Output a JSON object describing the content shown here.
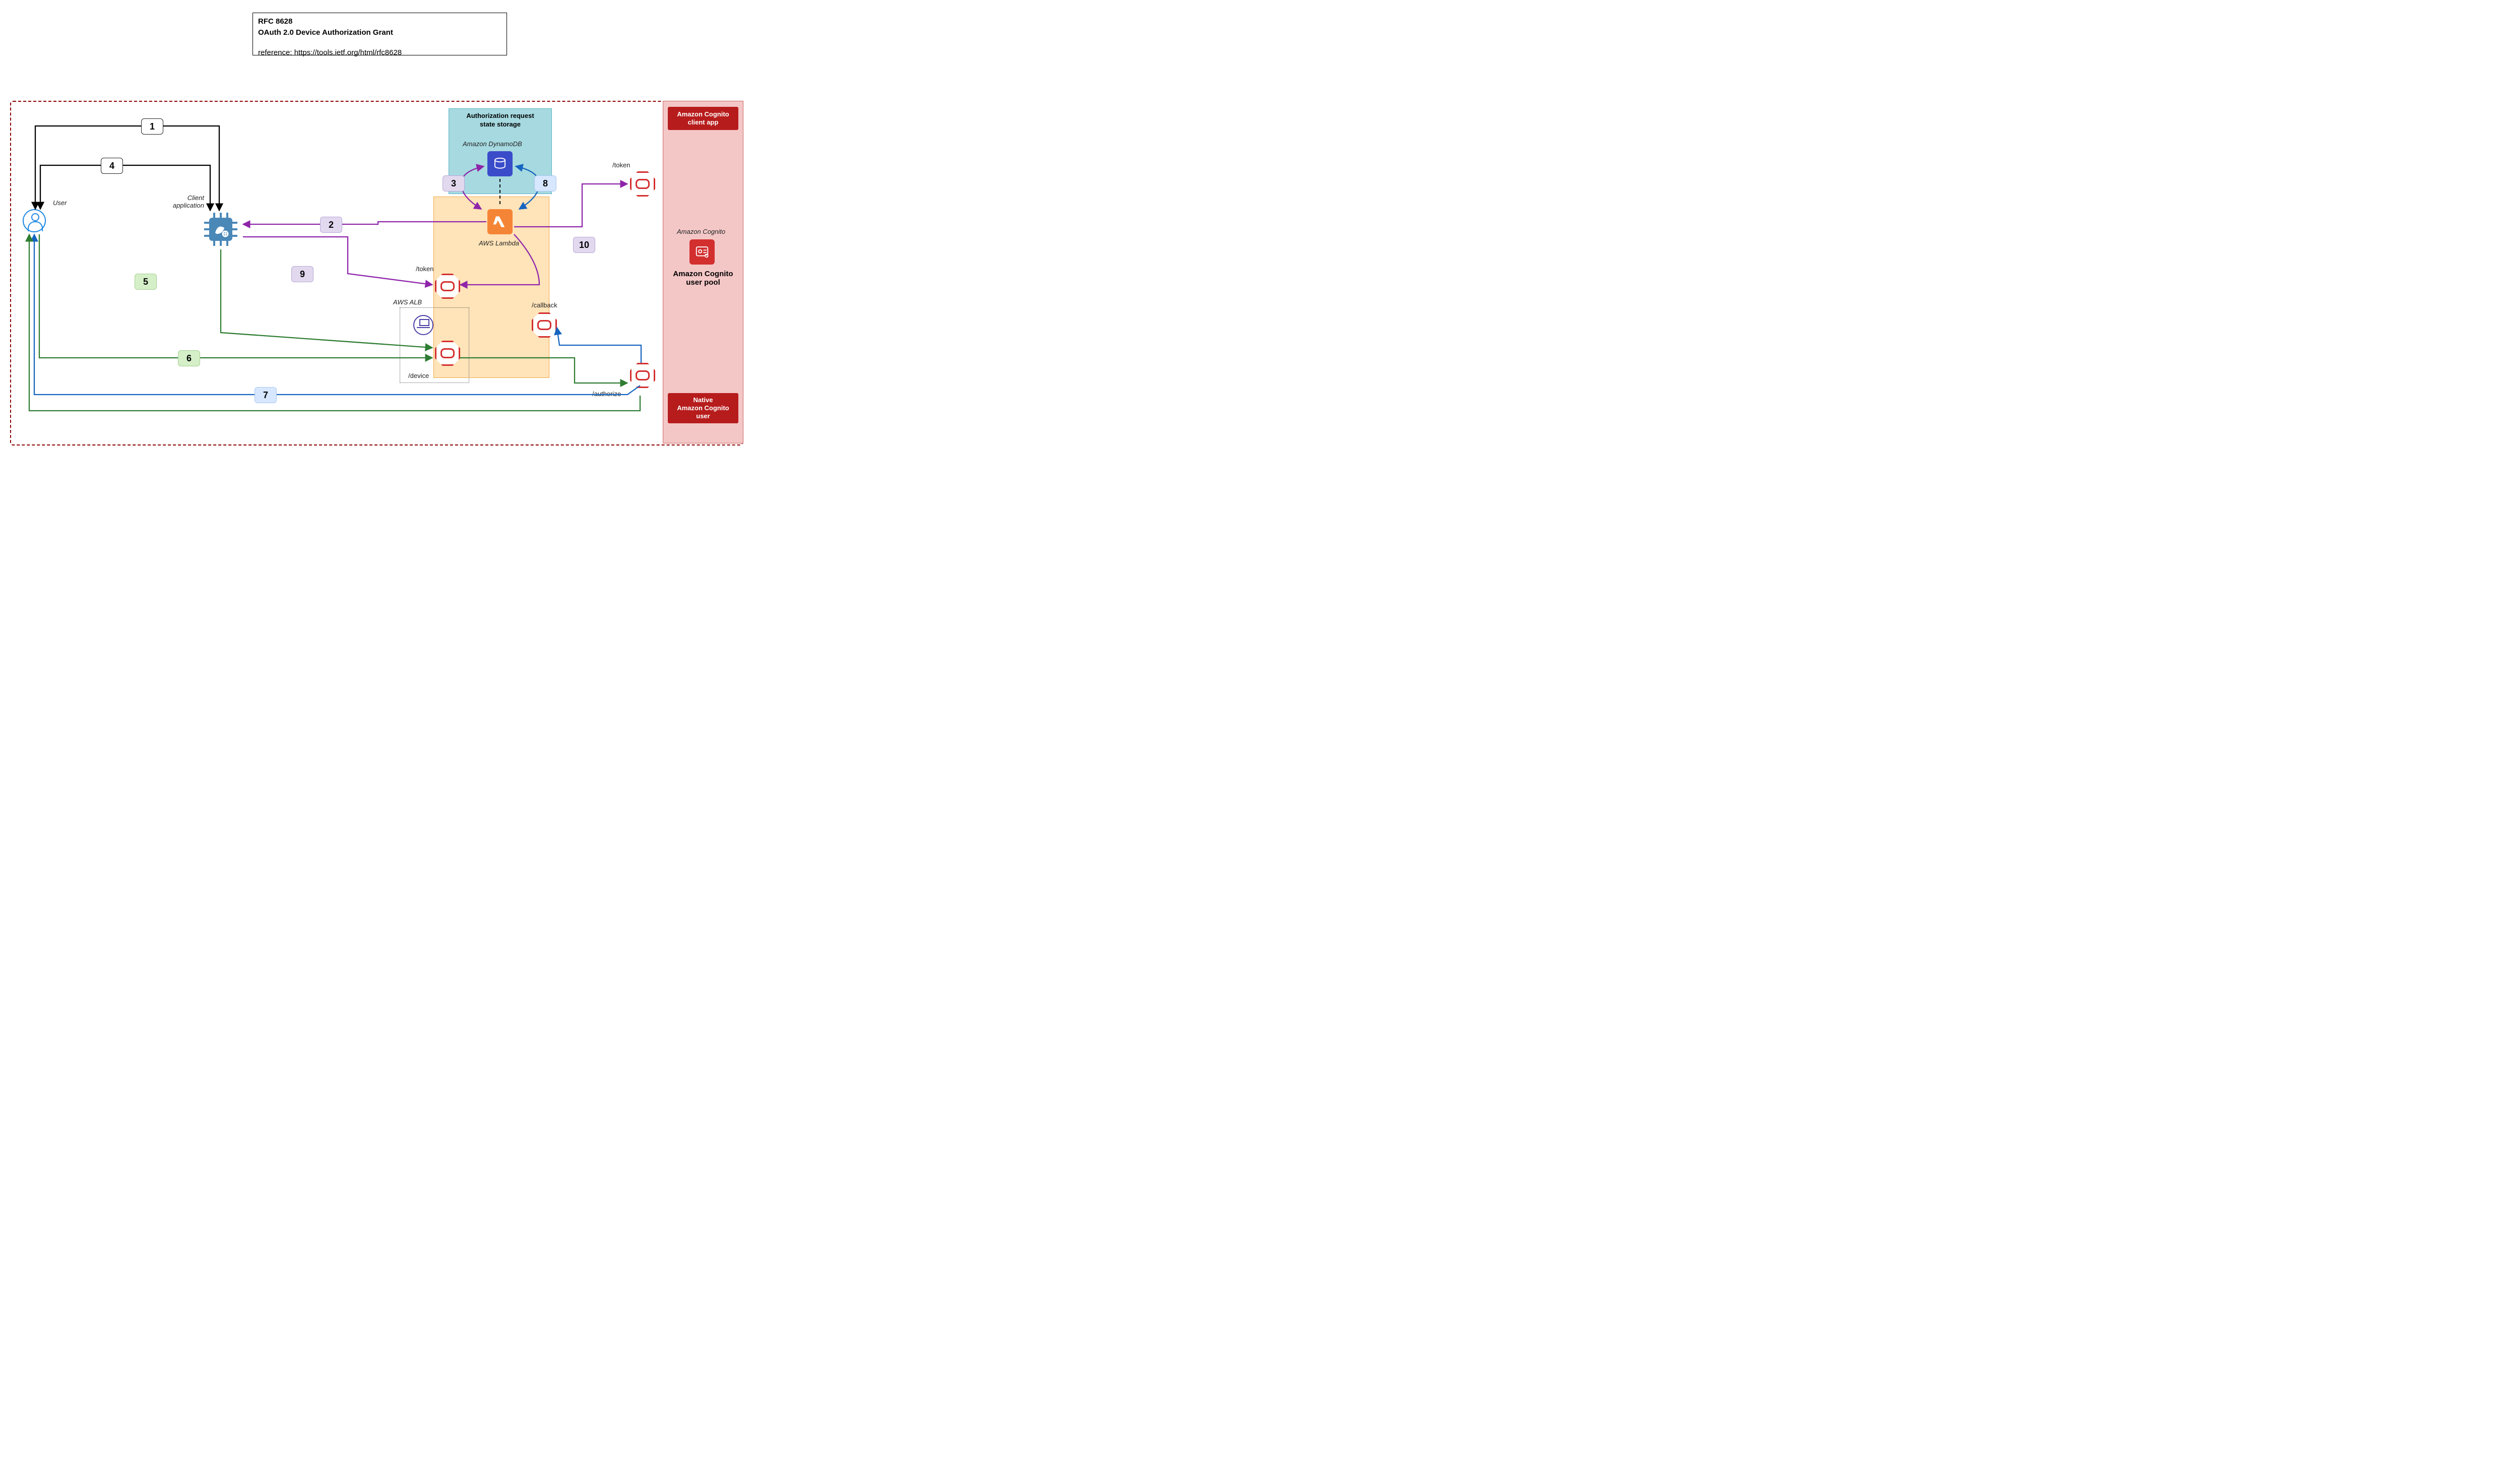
{
  "title": {
    "rfc": "RFC 8628",
    "name": "OAuth 2.0 Device Authorization Grant",
    "reference": "reference: https://tools.ietf.org/html/rfc8628"
  },
  "labels": {
    "user": "User",
    "client_app": "Client\napplication",
    "aws_alb": "AWS ALB",
    "authz_state_hdr": "Authorization request\nstate storage",
    "dynamodb": "Amazon DynamoDB",
    "aws_lambda": "AWS Lambda",
    "cognito_svc": "Amazon Cognito",
    "cognito_pool": "Amazon Cognito\nuser pool",
    "cognito_client_app": "Amazon Cognito\nclient app",
    "cognito_native_user": "Native\nAmazon Cognito\nuser"
  },
  "endpoints": {
    "token_left": "/token",
    "device": "/device",
    "callback": "/callback",
    "token_right": "/token",
    "authorize": "/authorize"
  },
  "steps": {
    "s1": "1",
    "s2": "2",
    "s3": "3",
    "s4": "4",
    "s5": "5",
    "s6": "6",
    "s7": "7",
    "s8": "8",
    "s9": "9",
    "s10": "10"
  }
}
